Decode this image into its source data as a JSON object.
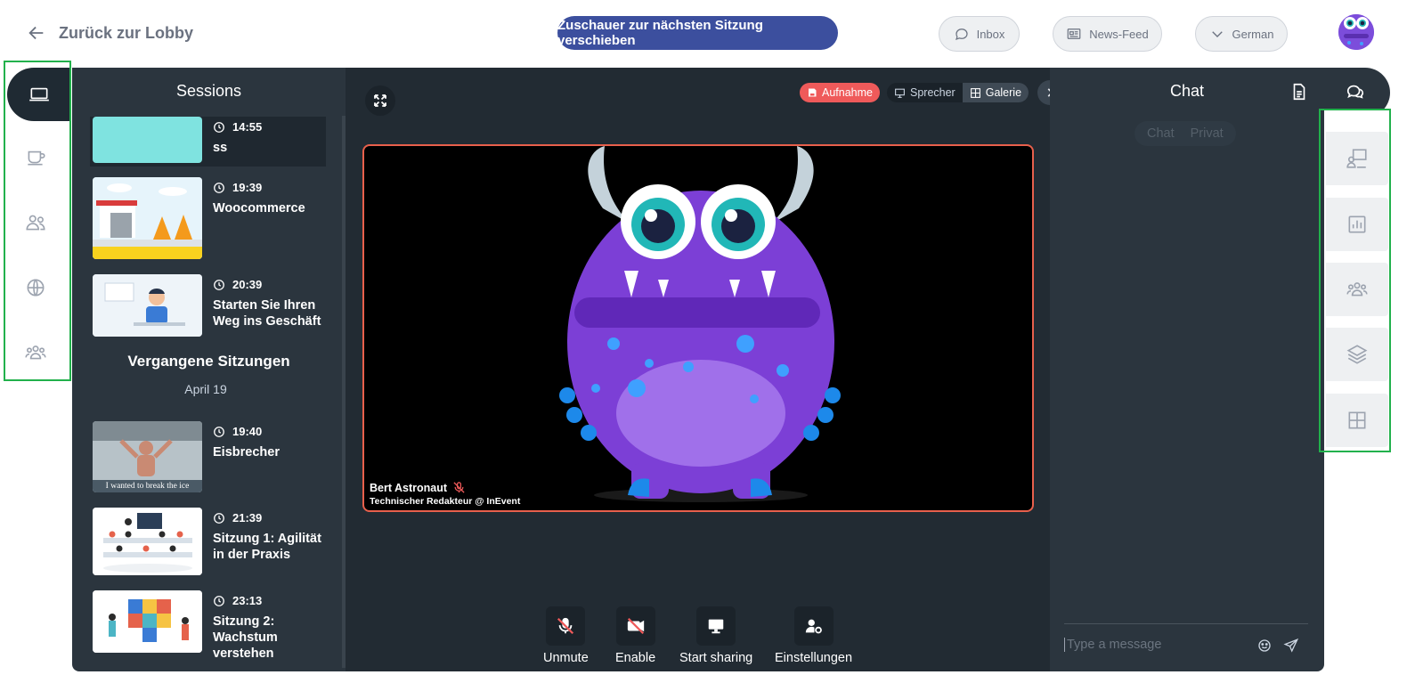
{
  "header": {
    "back_label": "Zurück zur Lobby",
    "move_button": "Zuschauer zur nächsten Sitzung verschieben",
    "inbox_label": "Inbox",
    "newsfeed_label": "News-Feed",
    "language_label": "German"
  },
  "sessions": {
    "title": "Sessions",
    "upcoming": [
      {
        "time": "14:55",
        "name": "ss"
      },
      {
        "time": "19:39",
        "name": "Woocommerce"
      },
      {
        "time": "20:39",
        "name": "Starten Sie Ihren Weg ins Geschäft"
      }
    ],
    "past_title": "Vergangene Sitzungen",
    "past_date": "April 19",
    "past": [
      {
        "time": "19:40",
        "name": "Eisbrecher",
        "caption": "I wanted to break the ice"
      },
      {
        "time": "21:39",
        "name": "Sitzung 1: Agilität in der Praxis"
      },
      {
        "time": "23:13",
        "name": "Sitzung 2: Wachstum verstehen"
      }
    ]
  },
  "stage": {
    "record_label": "Aufnahme",
    "speaker_view": "Sprecher",
    "gallery_view": "Galerie",
    "speaker_name": "Bert Astronaut",
    "speaker_role": "Technischer Redakteur @ InEvent",
    "controls": {
      "unmute": "Unmute",
      "enable": "Enable",
      "share": "Start sharing",
      "settings": "Einstellungen"
    }
  },
  "chat": {
    "title": "Chat",
    "tab_chat": "Chat",
    "tab_private": "Privat",
    "input_placeholder": "Type a message"
  },
  "colors": {
    "accent": "#3c4f9e",
    "panel": "#2b353e",
    "record": "#ef5a5a",
    "highlight_box": "#22b14c"
  }
}
